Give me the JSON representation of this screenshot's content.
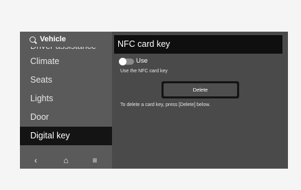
{
  "sidebar": {
    "title": "Vehicle",
    "items": [
      {
        "label": "Driver assistance"
      },
      {
        "label": "Climate"
      },
      {
        "label": "Seats"
      },
      {
        "label": "Lights"
      },
      {
        "label": "Door"
      },
      {
        "label": "Digital key"
      }
    ],
    "selected_index": 5,
    "bottom_bar": {
      "back": "‹",
      "home": "⌂",
      "menu": "≡"
    }
  },
  "panel": {
    "title": "NFC card key",
    "toggle": {
      "label": "Use",
      "description": "Use the NFC card key",
      "state": "off"
    },
    "delete_button": "Delete",
    "delete_description": "To delete a card key, press [Delete] below."
  },
  "colors": {
    "screen_bg": "#4a4a4a",
    "sidebar_bg": "#5a5a5a",
    "selected_bg": "#141414",
    "title_bar_bg": "#0f0f0f"
  }
}
